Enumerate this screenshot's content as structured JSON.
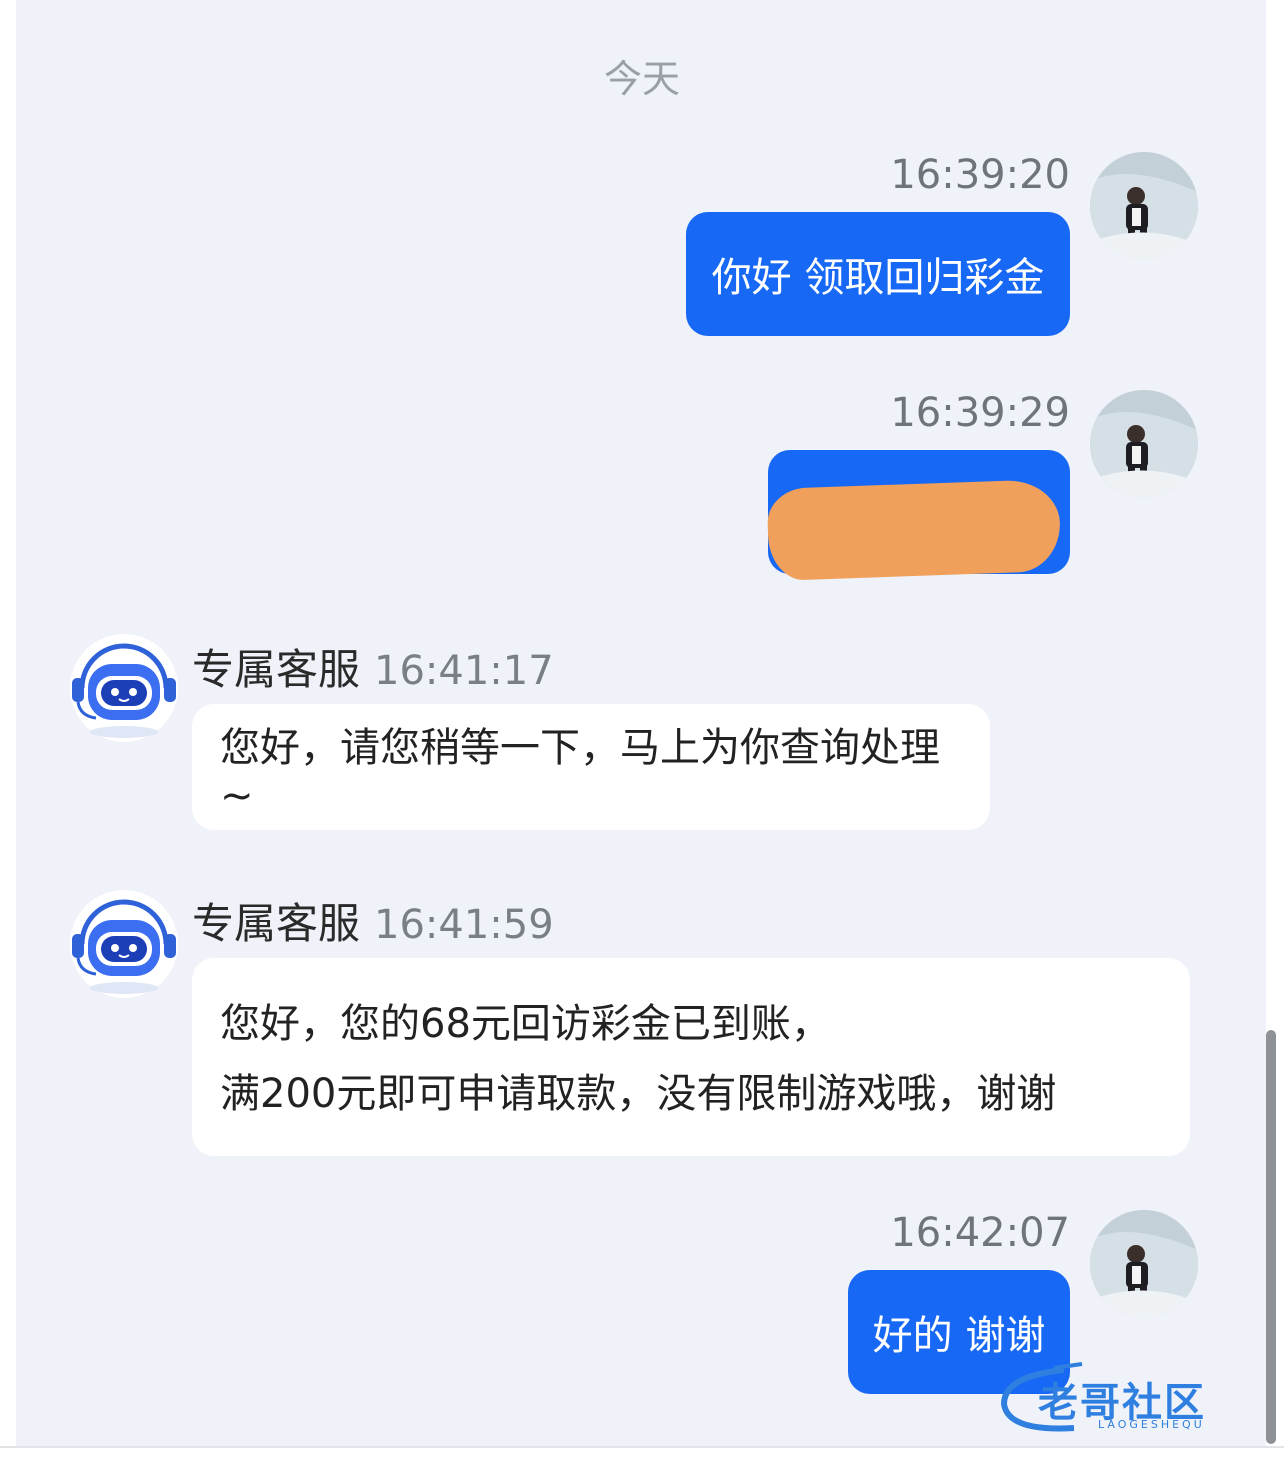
{
  "chat": {
    "day_label": "今天",
    "messages": [
      {
        "side": "out",
        "time": "16:39:20",
        "text": "你好 领取回归彩金"
      },
      {
        "side": "out",
        "time": "16:39:29",
        "text": ""
      },
      {
        "side": "in",
        "sender": "专属客服",
        "time": "16:41:17",
        "lines": [
          "您好，请您稍等一下，马上为你查询处理~"
        ]
      },
      {
        "side": "in",
        "sender": "专属客服",
        "time": "16:41:59",
        "lines": [
          "您好，您的68元回访彩金已到账，",
          "满200元即可申请取款，没有限制游戏哦，谢谢"
        ]
      },
      {
        "side": "out",
        "time": "16:42:07",
        "text": "好的 谢谢"
      }
    ]
  },
  "watermark": {
    "text": "老哥社区",
    "subtext": "LAOGESHEQU"
  },
  "colors": {
    "outgoing_bubble": "#1769f5",
    "chat_bg": "#eff2f8",
    "redaction": "#f0a05a"
  },
  "icons": {
    "user_avatar": "user-avatar-photo",
    "agent_avatar": "robot-headset-icon"
  }
}
